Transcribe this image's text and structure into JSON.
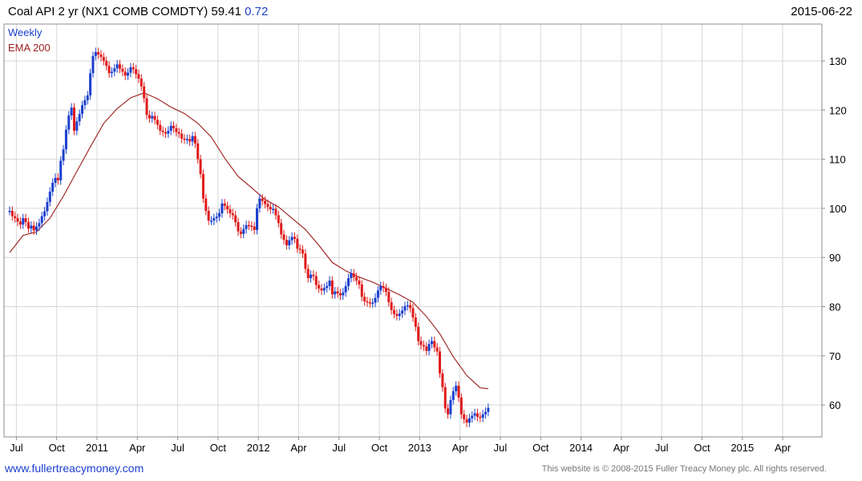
{
  "header": {
    "title_main": "Coal API 2 yr  (NX1 COMB COMDTY) 59.41",
    "title_change": "0.72",
    "date": "2015-06-22"
  },
  "legend": {
    "series1": "Weekly",
    "series2": "EMA 200"
  },
  "footer": {
    "left": "www.fullertreacymoney.com",
    "right": "This website is © 2008-2015 Fuller Treacy Money plc. All rights reserved."
  },
  "colors": {
    "up": "#1a3fcf",
    "down": "#e01a1a",
    "ema": "#9b1c1c",
    "grid": "#d8d8d8",
    "frame": "#8c8c8c"
  },
  "chart_data": {
    "type": "line",
    "ylim": [
      53.5,
      137.5
    ],
    "y_ticks": [
      60,
      70,
      80,
      90,
      100,
      110,
      120,
      130
    ],
    "x_ticks": [
      {
        "label": "Jul",
        "x": 2.5
      },
      {
        "label": "Oct",
        "x": 5.5
      },
      {
        "label": "2011",
        "x": 8.5
      },
      {
        "label": "Apr",
        "x": 11.5
      },
      {
        "label": "Jul",
        "x": 14.5
      },
      {
        "label": "Oct",
        "x": 17.5
      },
      {
        "label": "2012",
        "x": 20.5
      },
      {
        "label": "Apr",
        "x": 23.5
      },
      {
        "label": "Jul",
        "x": 26.5
      },
      {
        "label": "Oct",
        "x": 29.5
      },
      {
        "label": "2013",
        "x": 32.5
      },
      {
        "label": "Apr",
        "x": 35.5
      },
      {
        "label": "Jul",
        "x": 38.5
      },
      {
        "label": "Oct",
        "x": 41.5
      },
      {
        "label": "2014",
        "x": 44.5
      },
      {
        "label": "Apr",
        "x": 47.5
      },
      {
        "label": "Jul",
        "x": 50.5
      },
      {
        "label": "Oct",
        "x": 53.5
      },
      {
        "label": "2015",
        "x": 56.5
      },
      {
        "label": "Apr",
        "x": 59.5
      }
    ],
    "x_range": [
      2.0,
      62.0
    ],
    "weekly_close": [
      [
        2.0,
        99.5
      ],
      [
        2.2,
        98.4
      ],
      [
        2.4,
        98.0
      ],
      [
        2.6,
        97.3
      ],
      [
        2.8,
        96.7
      ],
      [
        3.0,
        98.0
      ],
      [
        3.2,
        97.2
      ],
      [
        3.4,
        95.9
      ],
      [
        3.6,
        96.5
      ],
      [
        3.8,
        95.5
      ],
      [
        4.0,
        96.3
      ],
      [
        4.2,
        97.0
      ],
      [
        4.4,
        98.4
      ],
      [
        4.6,
        99.4
      ],
      [
        4.8,
        101.3
      ],
      [
        5.0,
        103.4
      ],
      [
        5.2,
        105.2
      ],
      [
        5.4,
        106.2
      ],
      [
        5.6,
        105.7
      ],
      [
        5.8,
        109.7
      ],
      [
        6.0,
        112.0
      ],
      [
        6.2,
        116.0
      ],
      [
        6.4,
        118.9
      ],
      [
        6.6,
        120.5
      ],
      [
        6.8,
        115.8
      ],
      [
        7.0,
        117.7
      ],
      [
        7.2,
        119.2
      ],
      [
        7.4,
        121.0
      ],
      [
        7.6,
        122.0
      ],
      [
        7.8,
        123.0
      ],
      [
        8.0,
        127.5
      ],
      [
        8.2,
        131.0
      ],
      [
        8.4,
        131.8
      ],
      [
        8.6,
        131.3
      ],
      [
        8.8,
        130.8
      ],
      [
        9.0,
        130.0
      ],
      [
        9.2,
        129.0
      ],
      [
        9.4,
        127.5
      ],
      [
        9.6,
        127.8
      ],
      [
        9.8,
        128.5
      ],
      [
        10.0,
        129.3
      ],
      [
        10.2,
        128.4
      ],
      [
        10.4,
        127.8
      ],
      [
        10.6,
        127.0
      ],
      [
        10.8,
        127.6
      ],
      [
        11.0,
        128.7
      ],
      [
        11.2,
        128.3
      ],
      [
        11.4,
        127.3
      ],
      [
        11.6,
        126.4
      ],
      [
        11.8,
        124.8
      ],
      [
        12.0,
        122.4
      ],
      [
        12.2,
        119.0
      ],
      [
        12.4,
        118.3
      ],
      [
        12.6,
        118.8
      ],
      [
        12.8,
        118.0
      ],
      [
        13.0,
        117.0
      ],
      [
        13.2,
        115.8
      ],
      [
        13.4,
        115.5
      ],
      [
        13.6,
        115.2
      ],
      [
        13.8,
        115.8
      ],
      [
        14.0,
        116.8
      ],
      [
        14.2,
        116.3
      ],
      [
        14.4,
        115.5
      ],
      [
        14.6,
        115.2
      ],
      [
        14.8,
        114.2
      ],
      [
        15.0,
        114.0
      ],
      [
        15.2,
        114.1
      ],
      [
        15.4,
        113.6
      ],
      [
        15.6,
        114.7
      ],
      [
        15.8,
        113.2
      ],
      [
        16.0,
        110.0
      ],
      [
        16.2,
        107.0
      ],
      [
        16.4,
        102.0
      ],
      [
        16.6,
        99.5
      ],
      [
        16.8,
        97.5
      ],
      [
        17.0,
        97.5
      ],
      [
        17.2,
        98.0
      ],
      [
        17.4,
        98.3
      ],
      [
        17.6,
        99.0
      ],
      [
        17.8,
        101.0
      ],
      [
        18.0,
        100.5
      ],
      [
        18.2,
        99.8
      ],
      [
        18.4,
        99.0
      ],
      [
        18.6,
        98.6
      ],
      [
        18.8,
        97.2
      ],
      [
        19.0,
        95.3
      ],
      [
        19.2,
        94.8
      ],
      [
        19.4,
        95.8
      ],
      [
        19.6,
        96.6
      ],
      [
        19.8,
        96.5
      ],
      [
        20.0,
        96.3
      ],
      [
        20.2,
        95.6
      ],
      [
        20.4,
        100.0
      ],
      [
        20.6,
        102.0
      ],
      [
        20.8,
        101.5
      ],
      [
        21.0,
        100.9
      ],
      [
        21.2,
        100.3
      ],
      [
        21.4,
        99.8
      ],
      [
        21.6,
        99.9
      ],
      [
        21.8,
        98.6
      ],
      [
        22.0,
        97.0
      ],
      [
        22.2,
        94.7
      ],
      [
        22.4,
        93.6
      ],
      [
        22.6,
        92.5
      ],
      [
        22.8,
        93.5
      ],
      [
        23.0,
        94.2
      ],
      [
        23.2,
        93.8
      ],
      [
        23.4,
        91.8
      ],
      [
        23.6,
        91.6
      ],
      [
        23.8,
        90.8
      ],
      [
        24.0,
        87.7
      ],
      [
        24.2,
        85.8
      ],
      [
        24.4,
        86.5
      ],
      [
        24.6,
        86.2
      ],
      [
        24.8,
        84.4
      ],
      [
        25.0,
        83.7
      ],
      [
        25.2,
        83.3
      ],
      [
        25.4,
        83.8
      ],
      [
        25.6,
        84.2
      ],
      [
        25.8,
        85.3
      ],
      [
        26.0,
        82.5
      ],
      [
        26.2,
        83.1
      ],
      [
        26.4,
        82.7
      ],
      [
        26.6,
        82.3
      ],
      [
        26.8,
        82.9
      ],
      [
        27.0,
        84.2
      ],
      [
        27.2,
        85.8
      ],
      [
        27.4,
        86.8
      ],
      [
        27.6,
        86.0
      ],
      [
        27.8,
        85.3
      ],
      [
        28.0,
        84.5
      ],
      [
        28.2,
        82.0
      ],
      [
        28.4,
        81.1
      ],
      [
        28.6,
        80.9
      ],
      [
        28.8,
        80.7
      ],
      [
        29.0,
        80.8
      ],
      [
        29.2,
        81.8
      ],
      [
        29.4,
        83.3
      ],
      [
        29.6,
        84.2
      ],
      [
        29.8,
        83.8
      ],
      [
        30.0,
        83.0
      ],
      [
        30.2,
        80.9
      ],
      [
        30.4,
        79.3
      ],
      [
        30.6,
        78.5
      ],
      [
        30.8,
        78.1
      ],
      [
        31.0,
        78.6
      ],
      [
        31.2,
        79.2
      ],
      [
        31.4,
        80.1
      ],
      [
        31.6,
        80.3
      ],
      [
        31.8,
        79.7
      ],
      [
        32.0,
        77.8
      ],
      [
        32.2,
        75.9
      ],
      [
        32.4,
        73.0
      ],
      [
        32.6,
        72.2
      ],
      [
        32.8,
        71.9
      ],
      [
        33.0,
        71.0
      ],
      [
        33.2,
        72.4
      ],
      [
        33.4,
        73.0
      ],
      [
        33.6,
        71.7
      ],
      [
        33.8,
        70.9
      ],
      [
        34.0,
        66.4
      ],
      [
        34.2,
        63.6
      ],
      [
        34.4,
        59.3
      ],
      [
        34.6,
        58.1
      ],
      [
        34.8,
        61.0
      ],
      [
        35.0,
        62.8
      ],
      [
        35.2,
        63.9
      ],
      [
        35.4,
        61.5
      ],
      [
        35.6,
        58.1
      ],
      [
        35.8,
        57.1
      ],
      [
        36.0,
        56.4
      ],
      [
        36.2,
        57.3
      ],
      [
        36.4,
        57.8
      ],
      [
        36.6,
        58.3
      ],
      [
        36.8,
        57.6
      ],
      [
        37.0,
        57.4
      ],
      [
        37.2,
        58.1
      ],
      [
        37.4,
        58.6
      ],
      [
        37.6,
        59.4
      ]
    ],
    "ema_200": [
      [
        2.0,
        91.0
      ],
      [
        3.0,
        94.5
      ],
      [
        4.0,
        95.2
      ],
      [
        5.0,
        98.0
      ],
      [
        6.0,
        102.5
      ],
      [
        7.0,
        107.5
      ],
      [
        8.0,
        112.5
      ],
      [
        9.0,
        117.3
      ],
      [
        10.0,
        120.3
      ],
      [
        11.0,
        122.5
      ],
      [
        12.0,
        123.5
      ],
      [
        13.0,
        122.3
      ],
      [
        14.0,
        120.6
      ],
      [
        15.0,
        119.3
      ],
      [
        16.0,
        117.3
      ],
      [
        17.0,
        114.5
      ],
      [
        18.0,
        110.2
      ],
      [
        19.0,
        106.5
      ],
      [
        20.0,
        104.2
      ],
      [
        21.0,
        101.8
      ],
      [
        22.0,
        100.3
      ],
      [
        23.0,
        98.0
      ],
      [
        24.0,
        95.7
      ],
      [
        25.0,
        92.5
      ],
      [
        26.0,
        89.0
      ],
      [
        27.0,
        87.3
      ],
      [
        28.0,
        86.0
      ],
      [
        29.0,
        85.0
      ],
      [
        30.0,
        83.7
      ],
      [
        31.0,
        82.4
      ],
      [
        32.0,
        80.9
      ],
      [
        33.0,
        78.0
      ],
      [
        34.0,
        74.5
      ],
      [
        35.0,
        69.8
      ],
      [
        36.0,
        66.0
      ],
      [
        37.0,
        63.5
      ],
      [
        37.6,
        63.3
      ]
    ]
  }
}
